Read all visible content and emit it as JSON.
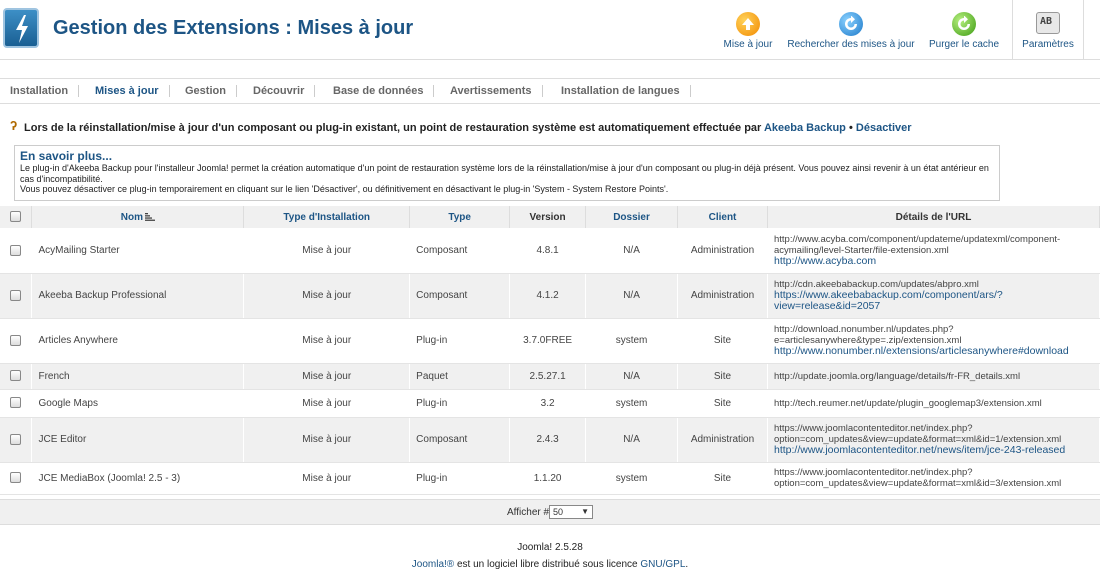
{
  "header": {
    "title": "Gestion des Extensions : Mises à jour",
    "toolbar": [
      {
        "label": "Mise à jour",
        "icon": "update-icon"
      },
      {
        "label": "Rechercher des mises à jour",
        "icon": "refresh-icon"
      },
      {
        "label": "Purger le cache",
        "icon": "purge-icon"
      },
      {
        "label": "Paramètres",
        "icon": "options-icon"
      }
    ]
  },
  "subnav": [
    {
      "label": "Installation",
      "active": false
    },
    {
      "label": "Mises à jour",
      "active": true
    },
    {
      "label": "Gestion",
      "active": false
    },
    {
      "label": "Découvrir",
      "active": false
    },
    {
      "label": "Base de données",
      "active": false
    },
    {
      "label": "Avertissements",
      "active": false
    },
    {
      "label": "Installation de langues",
      "active": false
    }
  ],
  "notice": {
    "text": "Lors de la réinstallation/mise à jour d'un composant ou plug-in existant, un point de restauration système est automatiquement effectuée par",
    "link": "Akeeba Backup",
    "separator": "•",
    "disable_link": "Désactiver"
  },
  "info": {
    "title": "En savoir plus...",
    "body": "Le plug-in d'Akeeba Backup pour l'installeur Joomla! permet la création automatique d'un point de restauration système lors de la réinstallation/mise à jour d'un composant ou plug-in déjà présent. Vous pouvez ainsi revenir à un état antérieur en cas d'incompatibilité.",
    "body2": "Vous pouvez désactiver ce plug-in temporairement en cliquant sur le lien 'Désactiver', ou définitivement en désactivant le plug-in 'System - System Restore Points'."
  },
  "table": {
    "headers": {
      "name": "Nom",
      "install_type": "Type d'Installation",
      "type": "Type",
      "version": "Version",
      "folder": "Dossier",
      "client": "Client",
      "url": "Détails de l'URL"
    },
    "rows": [
      {
        "name": "AcyMailing Starter",
        "install_type": "Mise à jour",
        "type": "Composant",
        "version": "4.8.1",
        "folder": "N/A",
        "client": "Administration",
        "url": "http://www.acyba.com/component/updateme/updatexml/component-acymailing/level-Starter/file-extension.xml",
        "link": "http://www.acyba.com"
      },
      {
        "name": "Akeeba Backup Professional",
        "install_type": "Mise à jour",
        "type": "Composant",
        "version": "4.1.2",
        "folder": "N/A",
        "client": "Administration",
        "url": "http://cdn.akeebabackup.com/updates/abpro.xml",
        "link": "https://www.akeebabackup.com/component/ars/?view=release&id=2057"
      },
      {
        "name": "Articles Anywhere",
        "install_type": "Mise à jour",
        "type": "Plug-in",
        "version": "3.7.0FREE",
        "folder": "system",
        "client": "Site",
        "url": "http://download.nonumber.nl/updates.php?e=articlesanywhere&type=.zip/extension.xml",
        "link": "http://www.nonumber.nl/extensions/articlesanywhere#download"
      },
      {
        "name": "French",
        "install_type": "Mise à jour",
        "type": "Paquet",
        "version": "2.5.27.1",
        "folder": "N/A",
        "client": "Site",
        "url": "http://update.joomla.org/language/details/fr-FR_details.xml",
        "link": ""
      },
      {
        "name": "Google Maps",
        "install_type": "Mise à jour",
        "type": "Plug-in",
        "version": "3.2",
        "folder": "system",
        "client": "Site",
        "url": "http://tech.reumer.net/update/plugin_googlemap3/extension.xml",
        "link": ""
      },
      {
        "name": "JCE Editor",
        "install_type": "Mise à jour",
        "type": "Composant",
        "version": "2.4.3",
        "folder": "N/A",
        "client": "Administration",
        "url": "https://www.joomlacontenteditor.net/index.php?option=com_updates&view=update&format=xml&id=1/extension.xml",
        "link": "http://www.joomlacontenteditor.net/news/item/jce-243-released"
      },
      {
        "name": "JCE MediaBox (Joomla! 2.5 - 3)",
        "install_type": "Mise à jour",
        "type": "Plug-in",
        "version": "1.1.20",
        "folder": "system",
        "client": "Site",
        "url": "https://www.joomlacontenteditor.net/index.php?option=com_updates&view=update&format=xml&id=3/extension.xml",
        "link": ""
      }
    ]
  },
  "pagination": {
    "label": "Afficher #",
    "value": "50"
  },
  "footer": {
    "version": "Joomla! 2.5.28",
    "license_link": "Joomla!®",
    "license_text": " est un logiciel libre distribué sous licence ",
    "gpl_link": "GNU/GPL",
    "period": "."
  }
}
